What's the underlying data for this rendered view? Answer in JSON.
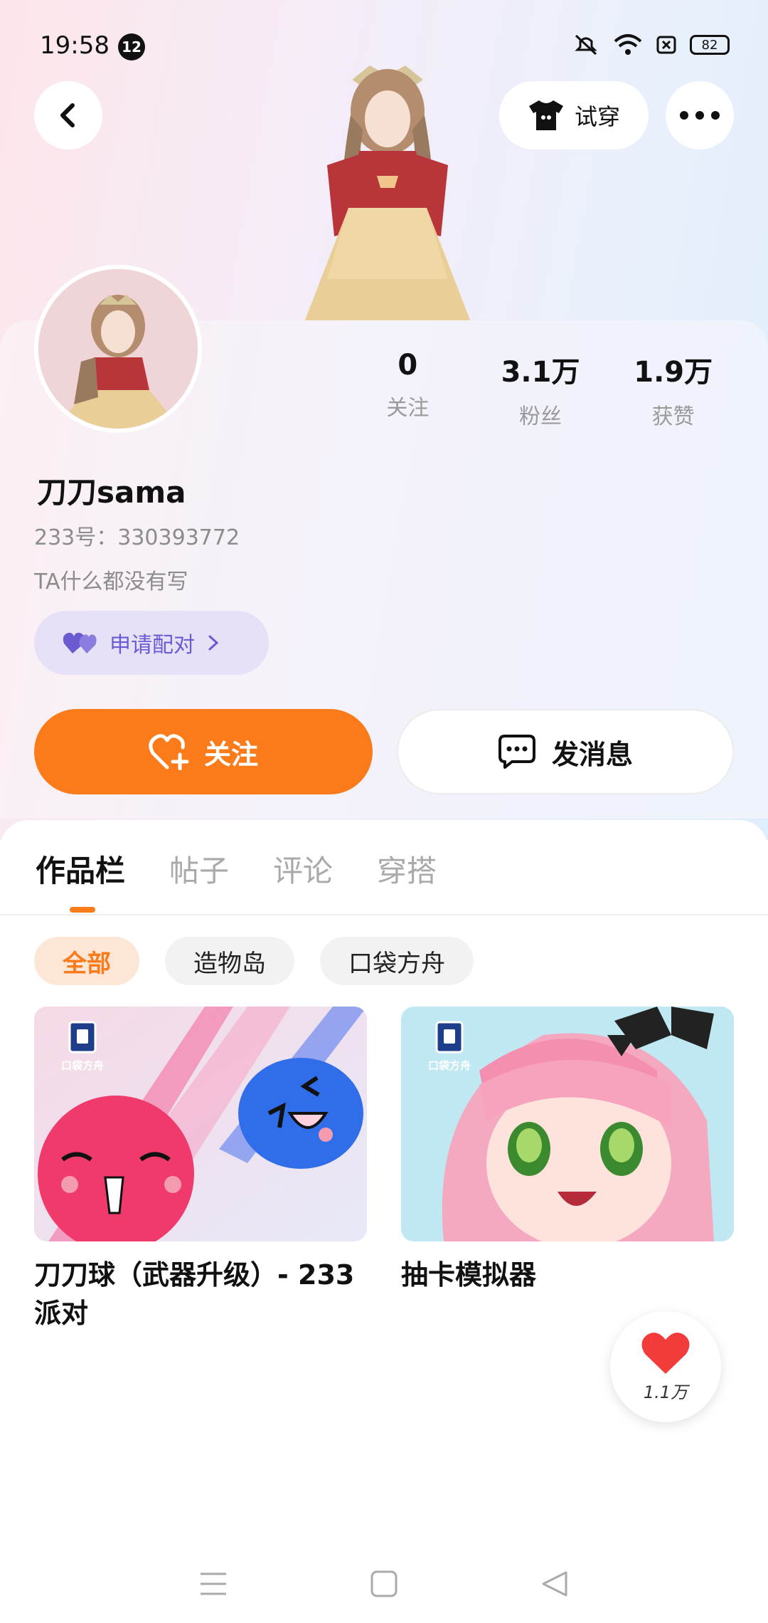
{
  "status_bar": {
    "time": "19:58",
    "notification_count": "12",
    "battery": "82",
    "icons": [
      "mute-icon",
      "wifi-icon",
      "sim-icon",
      "battery-icon"
    ]
  },
  "top_bar": {
    "try_on_label": "试穿",
    "icons": [
      "back-icon",
      "shirt-icon",
      "more-icon"
    ]
  },
  "profile": {
    "name": "刀刀sama",
    "uid": "233号：330393772",
    "bio": "TA什么都没有写",
    "pair_label": "申请配对",
    "stats": [
      {
        "value": "0",
        "label": "关注"
      },
      {
        "value": "3.1万",
        "label": "粉丝"
      },
      {
        "value": "1.9万",
        "label": "获赞"
      }
    ]
  },
  "actions": {
    "follow_label": "关注",
    "message_label": "发消息"
  },
  "tabs": [
    "作品栏",
    "帖子",
    "评论",
    "穿搭"
  ],
  "active_tab": "作品栏",
  "filters": [
    "全部",
    "造物岛",
    "口袋方舟"
  ],
  "active_filter": "全部",
  "works": [
    {
      "title": "刀刀球（武器升级）- 233派对",
      "badge": "口袋方舟"
    },
    {
      "title": "抽卡模拟器",
      "badge": "口袋方舟"
    }
  ],
  "floating_like": {
    "count": "1.1万"
  },
  "colors": {
    "accent": "#fb7a1a",
    "pair_purple": "#6b5bd3",
    "heart_red": "#f23b3b"
  }
}
